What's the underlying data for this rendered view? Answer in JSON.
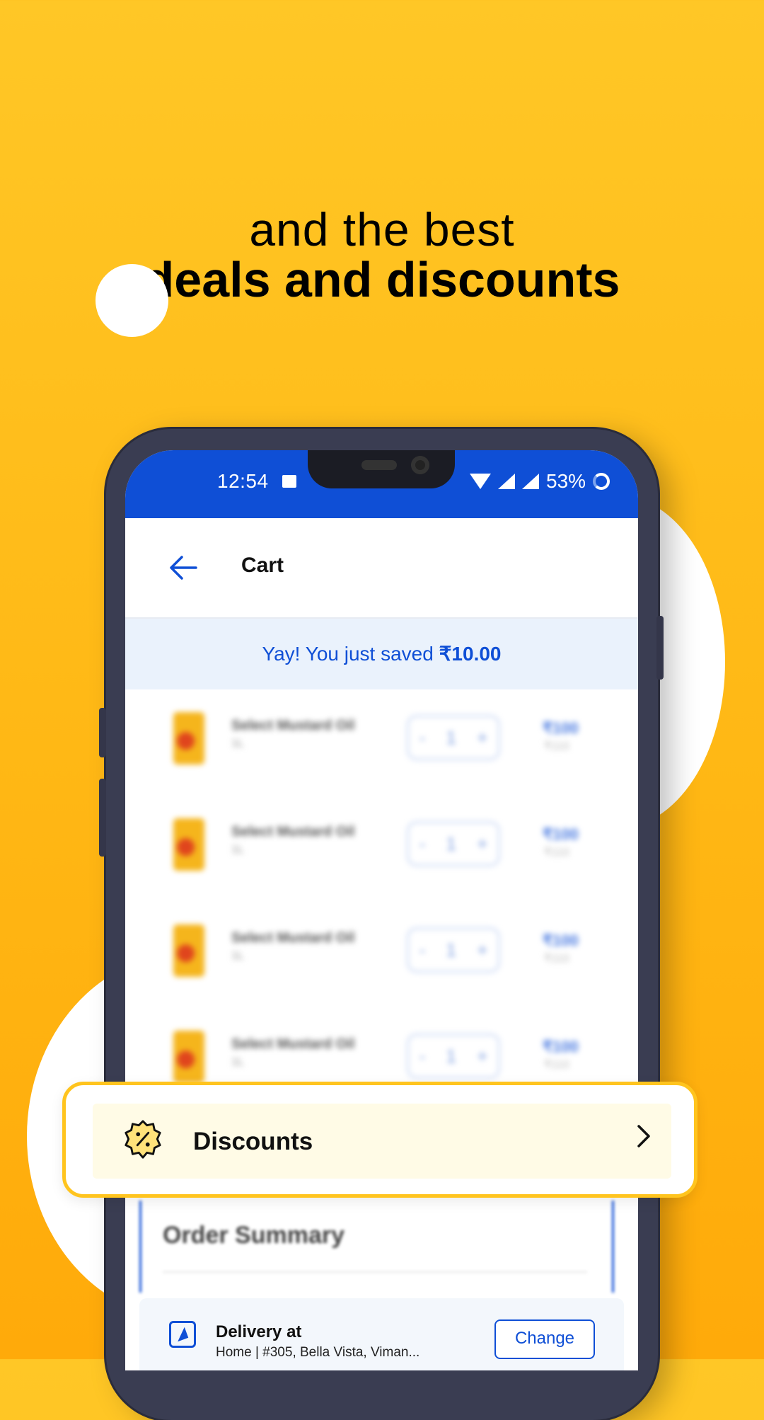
{
  "headline": {
    "line1": "and the best",
    "line2": "deals and discounts"
  },
  "status_bar": {
    "time": "12:54",
    "battery": "53%",
    "icons": [
      "image-icon",
      "wifi-icon",
      "signal-r-icon",
      "signal-icon",
      "battery-ring-icon"
    ]
  },
  "app_bar": {
    "title": "Cart",
    "back_icon": "arrow-left-icon"
  },
  "savings_banner": {
    "prefix": "Yay! You just saved ",
    "amount": "₹10.00"
  },
  "cart_items": [
    {
      "name": "Select Mustard Oil",
      "size": "1L",
      "qty": "1",
      "price": "₹100",
      "mrp": "₹110"
    },
    {
      "name": "Select Mustard Oil",
      "size": "1L",
      "qty": "1",
      "price": "₹100",
      "mrp": "₹110"
    },
    {
      "name": "Select Mustard Oil",
      "size": "1L",
      "qty": "1",
      "price": "₹100",
      "mrp": "₹110"
    },
    {
      "name": "Select Mustard Oil",
      "size": "1L",
      "qty": "1",
      "price": "₹100",
      "mrp": "₹110"
    }
  ],
  "qty_controls": {
    "minus": "-",
    "plus": "+"
  },
  "order_summary": {
    "title": "Order Summary"
  },
  "delivery": {
    "title": "Delivery at",
    "address": "Home | #305, Bella Vista, Viman...",
    "change_label": "Change"
  },
  "discounts": {
    "label": "Discounts",
    "icon": "percent-badge-icon",
    "chevron": "chevron-right-icon"
  },
  "colors": {
    "background": "#FFB815",
    "brand_blue": "#0F4FD6",
    "banner_bg": "#EAF2FC",
    "discount_border": "#FFC41E"
  }
}
